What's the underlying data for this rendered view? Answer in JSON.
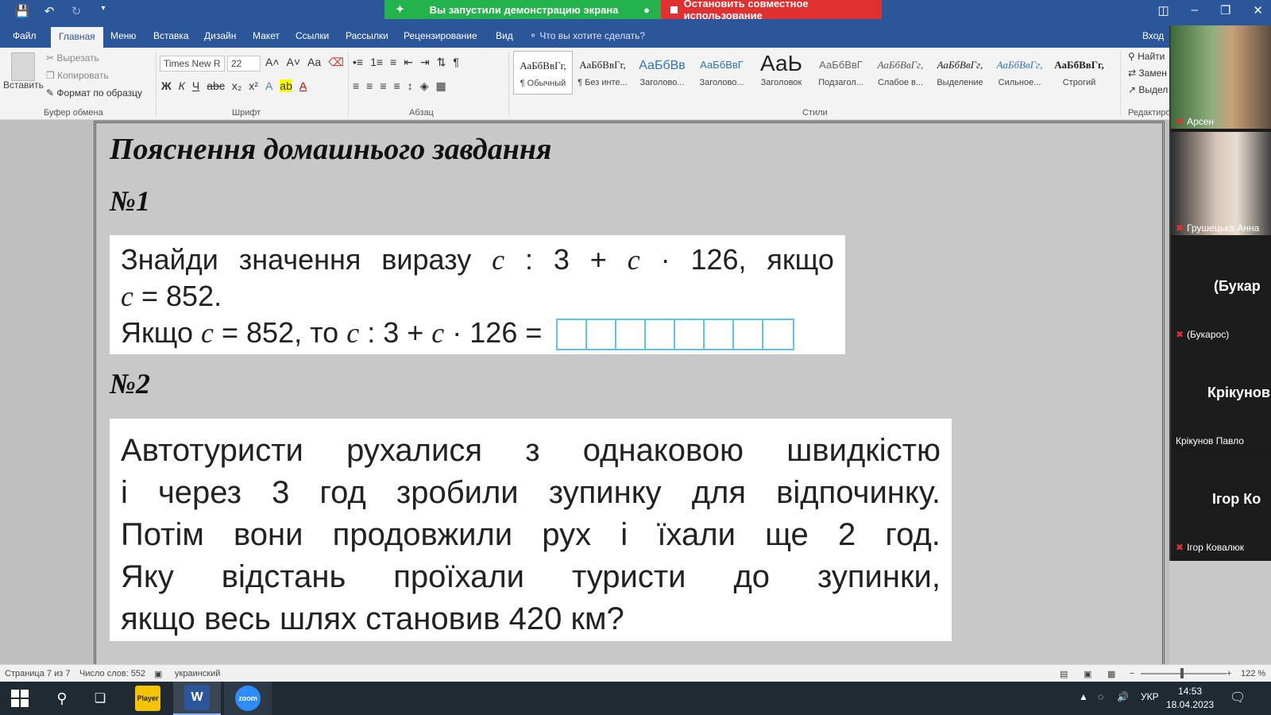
{
  "titlebar": {
    "share_active": "Вы запустили демонстрацию экрана",
    "share_stop": "Остановить совместное использование"
  },
  "tabs": [
    "Файл",
    "Главная",
    "Меню",
    "Вставка",
    "Дизайн",
    "Макет",
    "Ссылки",
    "Рассылки",
    "Рецензирование",
    "Вид"
  ],
  "tell_me": "Что вы хотите сделать?",
  "login": "Вход",
  "clipboard": {
    "paste": "Вставить",
    "cut": "Вырезать",
    "copy": "Копировать",
    "format_painter": "Формат по образцу",
    "label": "Буфер обмена"
  },
  "font": {
    "name": "Times New R",
    "size": "22",
    "label": "Шрифт"
  },
  "paragraph_label": "Абзац",
  "styles": {
    "label": "Стили",
    "items": [
      {
        "sample": "АаБбВвГг,",
        "name": "¶ Обычный"
      },
      {
        "sample": "АаБбВвГг,",
        "name": "¶ Без инте..."
      },
      {
        "sample": "АаБбВв",
        "name": "Заголово..."
      },
      {
        "sample": "АаБбВвГ",
        "name": "Заголово..."
      },
      {
        "sample": "АаЬ",
        "name": "Заголовок"
      },
      {
        "sample": "АаБбВвГ",
        "name": "Подзагол..."
      },
      {
        "sample": "АаБбВвГг,",
        "name": "Слабое в..."
      },
      {
        "sample": "АаБбВвГг,",
        "name": "Выделение"
      },
      {
        "sample": "АаБбВвГг,",
        "name": "Сильное..."
      },
      {
        "sample": "АаБбВвГг,",
        "name": "Строгий"
      }
    ]
  },
  "editing": {
    "find": "Найти",
    "replace": "Замен",
    "select": "Выдел",
    "label": "Редактиров"
  },
  "document": {
    "heading": "Пояснення домашнього завдання",
    "task1_num": "№1",
    "task1": {
      "l1_words": [
        "Знайди",
        "значення",
        "виразу"
      ],
      "expr": {
        "c": "c",
        "div": ":",
        "three": "3",
        "plus": "+",
        "dot": "·",
        "n126": "126,"
      },
      "l1_end": "якщо",
      "l2_eq": "= 852.",
      "l3_pre": "Якщо",
      "l3_eq": "= 852, то",
      "l3_expr_tail": ": 3 +",
      "l3_end": "· 126 ="
    },
    "task2_num": "№2",
    "task2_lines": [
      [
        "Автотуристи",
        "рухалися",
        "з",
        "однаковою",
        "швидкістю"
      ],
      [
        "і",
        "через",
        "3",
        "год",
        "зробили",
        "зупинку",
        "для",
        "відпочинку."
      ],
      [
        "Потім",
        "вони",
        "продовжили",
        "рух",
        "і",
        "їхали",
        "ще",
        "2",
        "год."
      ],
      [
        "Яку",
        "відстань",
        "проїхали",
        "туристи",
        "до",
        "зупинки,"
      ],
      [
        "якщо весь шлях становив 420 км?"
      ]
    ]
  },
  "participants": [
    {
      "name": "Арсен",
      "big": ""
    },
    {
      "name": "Грушецька Анна",
      "big": ""
    },
    {
      "name": "(Букарос)",
      "big": "(Букар"
    },
    {
      "name": "Крікунов Павло",
      "big": "Крікунов"
    },
    {
      "name": "Ігор Ковалюк",
      "big": "Ігор Ко"
    }
  ],
  "status": {
    "page": "Страница 7 из 7",
    "words": "Число слов: 552",
    "lang": "украинский",
    "zoom": "122 %"
  },
  "taskbar": {
    "lang": "УКР",
    "time": "14:53",
    "date": "18.04.2023",
    "player": "Player",
    "zoom_app": "zoom"
  },
  "colors": {
    "word_blue": "#2b579a",
    "share_green": "#23b24b",
    "share_red": "#e0302f",
    "answer_box": "#5cc6e6"
  }
}
